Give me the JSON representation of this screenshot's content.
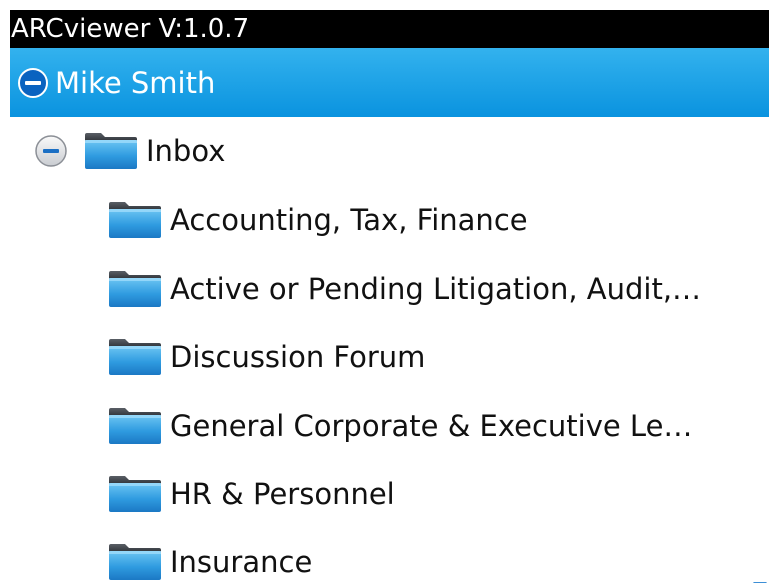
{
  "app": {
    "title": "ARCviewer V:1.0.7"
  },
  "account": {
    "name": "Mike Smith",
    "toggle_icon": "collapse-minus-icon",
    "highlight_color": "#1ea3e8"
  },
  "inbox": {
    "label": "Inbox",
    "toggle_icon": "collapse-minus-icon",
    "icon": "folder-icon"
  },
  "folders": [
    {
      "label": "Accounting, Tax, Finance",
      "icon": "folder-icon"
    },
    {
      "label": "Active or Pending Litigation, Audit,…",
      "icon": "folder-icon"
    },
    {
      "label": "Discussion Forum",
      "icon": "folder-icon"
    },
    {
      "label": "General Corporate & Executive Le…",
      "icon": "folder-icon"
    },
    {
      "label": "HR & Personnel",
      "icon": "folder-icon"
    },
    {
      "label": "Insurance",
      "icon": "folder-icon"
    }
  ],
  "scroll_indicator": "scroll-down-arrow-icon"
}
